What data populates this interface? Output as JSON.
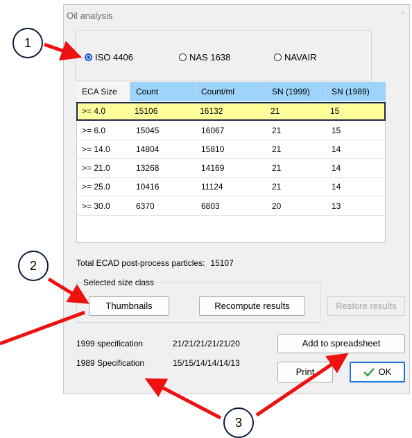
{
  "dialog": {
    "title": "Oil analysis",
    "close_glyph": "×"
  },
  "standards": {
    "options": [
      {
        "label": "ISO 4406",
        "selected": true
      },
      {
        "label": "NAS 1638",
        "selected": false
      },
      {
        "label": "NAVAIR",
        "selected": false
      }
    ]
  },
  "table": {
    "columns": [
      "ECA Size",
      "Count",
      "Count/ml",
      "SN (1999)",
      "SN (1989)"
    ],
    "rows": [
      [
        "&gt;= 4.0",
        "15106",
        "16132",
        "21",
        "15"
      ],
      [
        "&gt;= 6.0",
        "15045",
        "16067",
        "21",
        "15"
      ],
      [
        "&gt;= 14.0",
        "14804",
        "15810",
        "21",
        "14"
      ],
      [
        "&gt;= 21.0",
        "13268",
        "14169",
        "21",
        "14"
      ],
      [
        "&gt;= 25.0",
        "10416",
        "11124",
        "21",
        "14"
      ],
      [
        "&gt;= 30.0",
        "6370",
        "6803",
        "20",
        "13"
      ]
    ]
  },
  "summary": {
    "total_label": "Total ECAD post-process particles:",
    "total_value": "15107"
  },
  "size_class": {
    "label": "Selected size class",
    "thumbnails": "Thumbnails",
    "recompute": "Recompute results"
  },
  "restore": "Restore results",
  "specs": {
    "spec1999_label": "1999 specification",
    "spec1999_value": "21/21/21/21/21/20",
    "spec1989_label": "1989 Specification",
    "spec1989_value": "15/15/14/14/14/13"
  },
  "buttons": {
    "spreadsheet": "Add to spreadsheet",
    "print": "Print",
    "ok": "OK"
  },
  "annotations": {
    "badge1": "1",
    "badge2": "2",
    "badge3": "3",
    "arrow_color": "#ee1111"
  }
}
